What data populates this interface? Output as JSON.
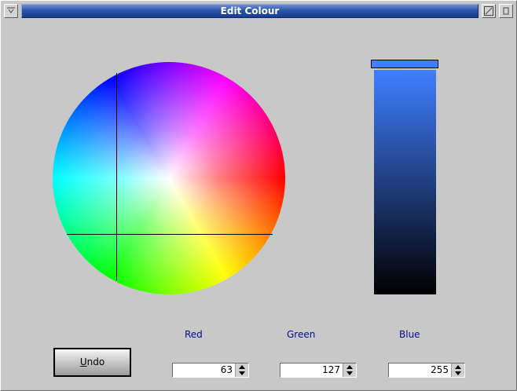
{
  "window": {
    "title": "Edit Colour"
  },
  "color": {
    "red": "63",
    "green": "127",
    "blue": "255",
    "preview_hex": "#3f7fff"
  },
  "labels": {
    "red": "Red",
    "green": "Green",
    "blue": "Blue"
  },
  "buttons": {
    "undo_mnemonic": "U",
    "undo_rest": "ndo"
  },
  "icons": {
    "menu": "window-menu-icon",
    "resize": "resize-icon",
    "maximize": "maximize-icon"
  }
}
